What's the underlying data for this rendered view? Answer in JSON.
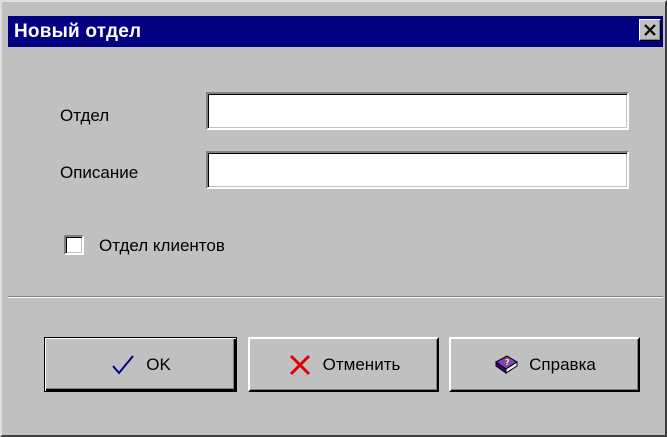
{
  "dialog": {
    "title": "Новый отдел",
    "close_icon": "close-icon"
  },
  "form": {
    "department_label": "Отдел",
    "department_value": "",
    "description_label": "Описание",
    "description_value": "",
    "client_dept_label": "Отдел клиентов",
    "client_dept_checked": false
  },
  "buttons": {
    "ok_label": "OK",
    "ok_icon": "checkmark-icon",
    "cancel_label": "Отменить",
    "cancel_icon": "red-x-icon",
    "help_label": "Справка",
    "help_icon": "help-book-icon"
  },
  "colors": {
    "titlebar": "#000080",
    "face": "#c0c0c0",
    "check_blue": "#000080",
    "cancel_red": "#e00000"
  }
}
